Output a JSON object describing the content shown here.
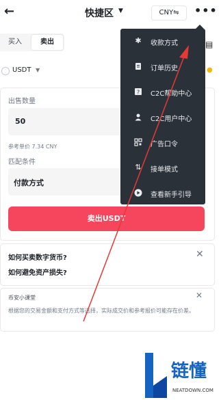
{
  "header": {
    "title": "快捷区",
    "currency": "CNY⇋",
    "more": "•••"
  },
  "tabs": {
    "buy": "买入",
    "sell": "卖出"
  },
  "asset": {
    "name": "USDT"
  },
  "form": {
    "qty_label": "出售数量",
    "qty_value": "50",
    "ref_price": "参考单价 7.34 CNY",
    "match_label": "匹配条件",
    "payment_label": "付款方式",
    "sell_button": "卖出USDT"
  },
  "faq": {
    "q1": "如何买卖数字货币?",
    "q2": "如何避免资产损失?"
  },
  "academy": {
    "title": "币安小课堂",
    "desc": "根据您的交易金额和支付方式等选择，实际成交价和参考报价可能存在价差。"
  },
  "menu": {
    "items": [
      {
        "label": "收款方式",
        "icon": "gear-icon"
      },
      {
        "label": "订单历史",
        "icon": "document-icon"
      },
      {
        "label": "C2C帮助中心",
        "icon": "help-icon"
      },
      {
        "label": "C2C用户中心",
        "icon": "user-icon"
      },
      {
        "label": "广告口令",
        "icon": "qr-icon"
      },
      {
        "label": "接单模式",
        "icon": "swap-icon"
      },
      {
        "label": "查看新手引导",
        "icon": "play-icon"
      }
    ]
  },
  "watermark": {
    "text": "链懂",
    "sub": "NEATDOWN.COM"
  },
  "colors": {
    "sell": "#f6465d",
    "menu_bg": "#2b3139",
    "brand": "#f0b90b",
    "watermark": "#1565c0"
  }
}
